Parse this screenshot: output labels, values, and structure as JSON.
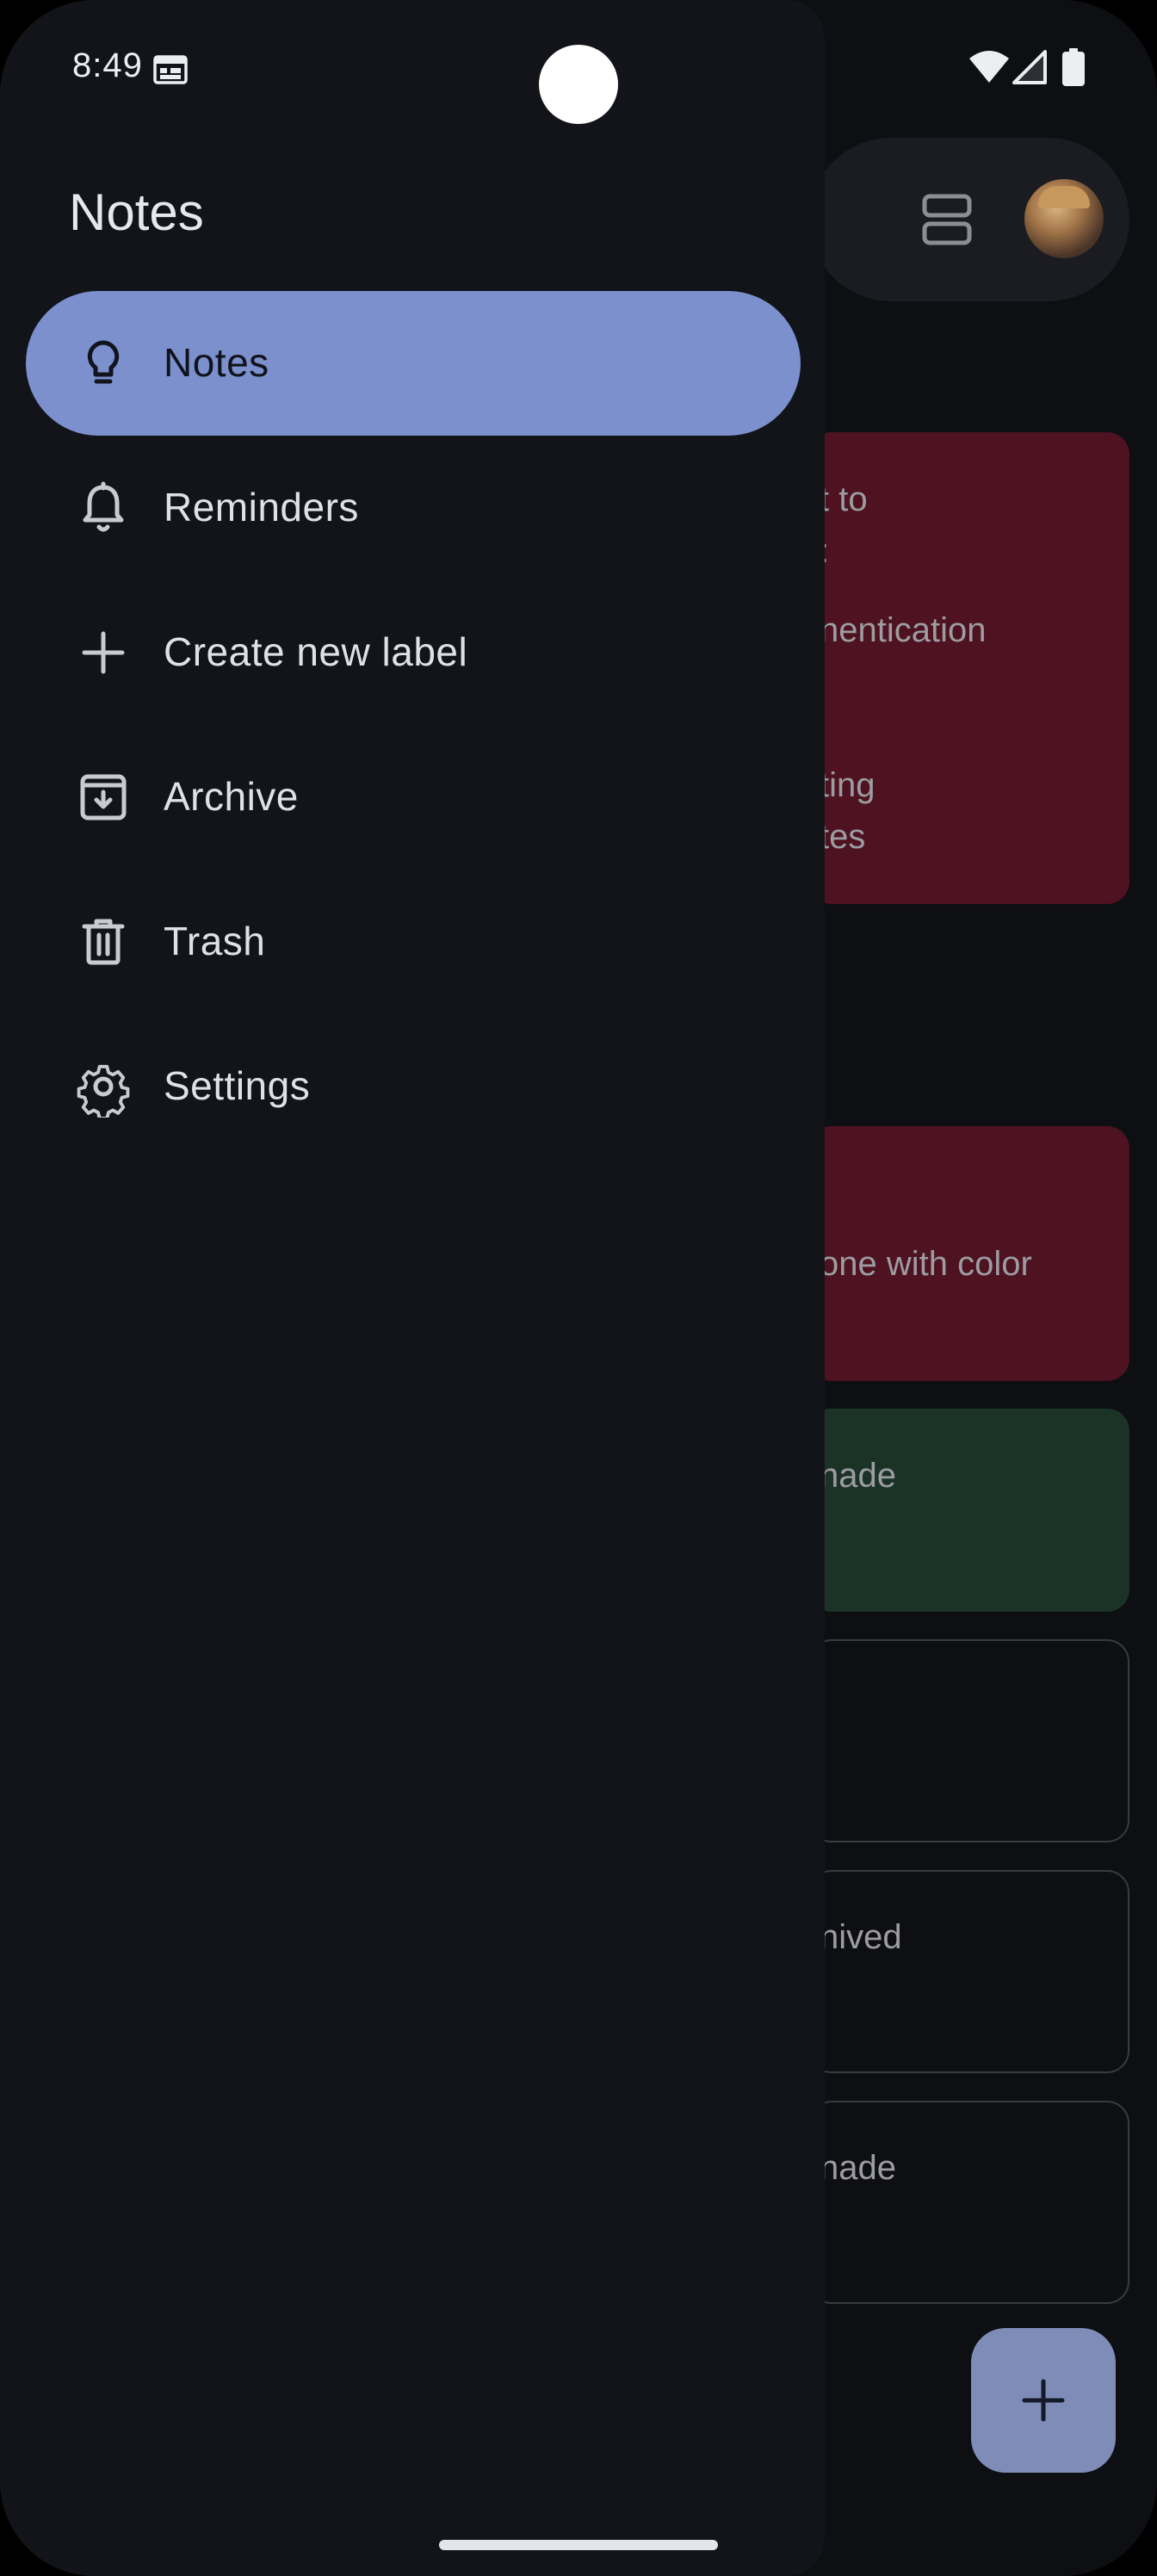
{
  "status_bar": {
    "time": "8:49",
    "icons": [
      "calendar-icon",
      "wifi-icon",
      "cellular-icon",
      "battery-icon"
    ]
  },
  "drawer": {
    "title": "Notes",
    "items": [
      {
        "label": "Notes",
        "icon": "lightbulb-icon",
        "active": true
      },
      {
        "label": "Reminders",
        "icon": "bell-icon",
        "active": false
      },
      {
        "label": "Create new label",
        "icon": "plus-icon",
        "active": false
      },
      {
        "label": "Archive",
        "icon": "archive-icon",
        "active": false
      },
      {
        "label": "Trash",
        "icon": "trash-icon",
        "active": false
      },
      {
        "label": "Settings",
        "icon": "gear-icon",
        "active": false
      }
    ]
  },
  "background": {
    "notes": [
      {
        "color": "red",
        "lines": [
          "t to",
          ":",
          "nentication",
          "ting",
          "tes"
        ]
      },
      {
        "color": "red",
        "lines": [
          "one with color"
        ]
      },
      {
        "color": "green",
        "lines": [
          "nade"
        ]
      },
      {
        "color": "none",
        "lines": []
      },
      {
        "color": "none",
        "lines": [
          "nived"
        ]
      },
      {
        "color": "none",
        "lines": [
          "nade"
        ]
      }
    ]
  },
  "colors": {
    "drawer_bg": "#13141a",
    "active_item": "#7b90cc",
    "note_red": "#4e1220",
    "note_green": "#1b3327",
    "fab": "#7e8cb7"
  }
}
